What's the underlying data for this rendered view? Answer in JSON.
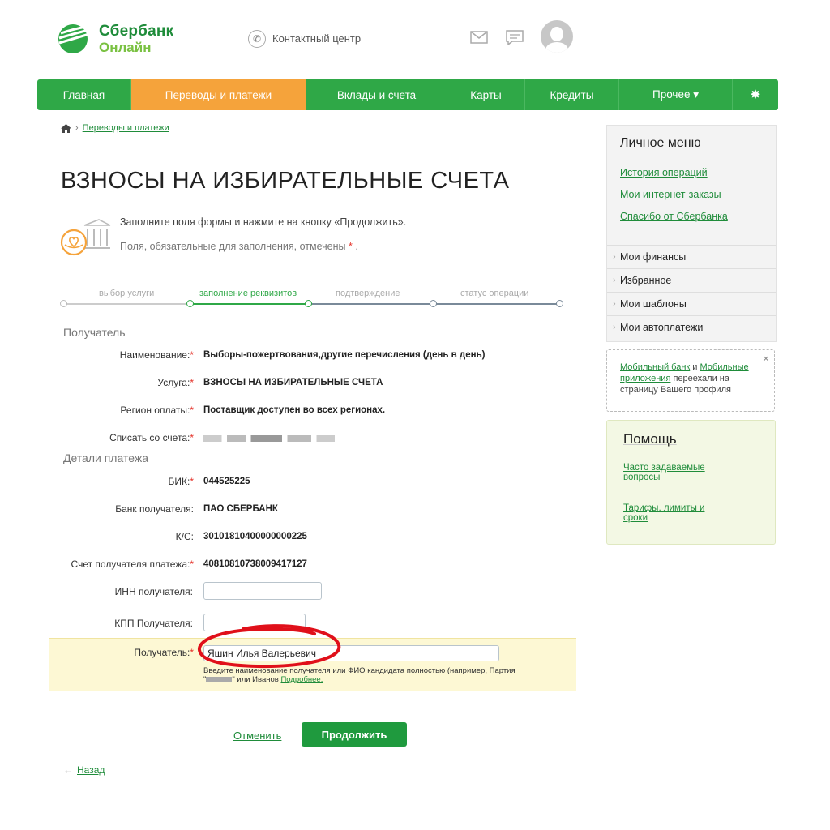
{
  "header": {
    "logo_line1": "Сбербанк",
    "logo_line2": "Онлайн",
    "contact_label": "Контактный центр",
    "icons": [
      "phone-icon",
      "mail-icon",
      "chat-icon",
      "avatar-icon"
    ]
  },
  "nav": {
    "items": [
      {
        "label": "Главная"
      },
      {
        "label": "Переводы и платежи",
        "active": true
      },
      {
        "label": "Вклады и счета"
      },
      {
        "label": "Карты"
      },
      {
        "label": "Кредиты"
      },
      {
        "label": "Прочее ▾"
      }
    ],
    "settings_icon": "gear-icon"
  },
  "breadcrumb": {
    "link": "Переводы и платежи"
  },
  "page": {
    "title": "ВЗНОСЫ НА ИЗБИРАТЕЛЬНЫЕ СЧЕТА",
    "hint": "Заполните поля формы и нажмите на кнопку «Продолжить».",
    "required_note": "Поля, обязательные для заполнения, отмечены",
    "required_mark": "*",
    "required_end": "."
  },
  "steps": [
    {
      "label": "выбор услуги",
      "state": "done"
    },
    {
      "label": "заполнение реквизитов",
      "state": "current"
    },
    {
      "label": "подтверждение",
      "state": "pending"
    },
    {
      "label": "статус операции",
      "state": "pending"
    }
  ],
  "recipient": {
    "section": "Получатель",
    "name_label": "Наименование:",
    "name_value": "Выборы-пожертвования,другие перечисления (день в день)",
    "service_label": "Услуга:",
    "service_value": "ВЗНОСЫ НА ИЗБИРАТЕЛЬНЫЕ СЧЕТА",
    "region_label": "Регион оплаты:",
    "region_value": "Поставщик доступен во всех регионах.",
    "account_label": "Списать со счета:"
  },
  "details": {
    "section": "Детали платежа",
    "bik_label": "БИК:",
    "bik_value": "044525225",
    "bank_label": "Банк получателя:",
    "bank_value": "ПАО СБЕРБАНК",
    "ks_label": "К/С:",
    "ks_value": "30101810400000000225",
    "account_label": "Счет получателя платежа:",
    "account_value": "40810810738009417127",
    "inn_label": "ИНН получателя:",
    "inn_value": "",
    "kpp_label": "КПП Получателя:",
    "kpp_value": "",
    "recipient_label": "Получатель:",
    "recipient_value": "Яшин Илья Валерьевич",
    "note_part1": "Введите наименование получателя или ФИО кандидата полностью (например, Партия",
    "note_part2": "\"",
    "note_part3": "\" или Иванов",
    "note_link": "Подробнее."
  },
  "actions": {
    "cancel": "Отменить",
    "continue": "Продолжить",
    "back": "Назад"
  },
  "sidebar": {
    "menu_title": "Личное меню",
    "links": [
      "История операций",
      "Мои интернет-заказы",
      "Спасибо от Сбербанка"
    ],
    "rows": [
      "Мои финансы",
      "Избранное",
      "Мои шаблоны",
      "Мои автоплатежи"
    ],
    "mobile_link1": "Мобильный банк",
    "mobile_and": "и",
    "mobile_link2": "Мобильные приложения",
    "mobile_text": "переехали на страницу Вашего профиля",
    "help_title": "Помощь",
    "help_links": [
      "Часто задаваемые вопросы",
      "Тарифы, лимиты и сроки"
    ]
  },
  "colors": {
    "brand_green": "#2fa847",
    "active_orange": "#f5a33b",
    "required_red": "#e5332a",
    "annotation_red": "#e0101a"
  }
}
